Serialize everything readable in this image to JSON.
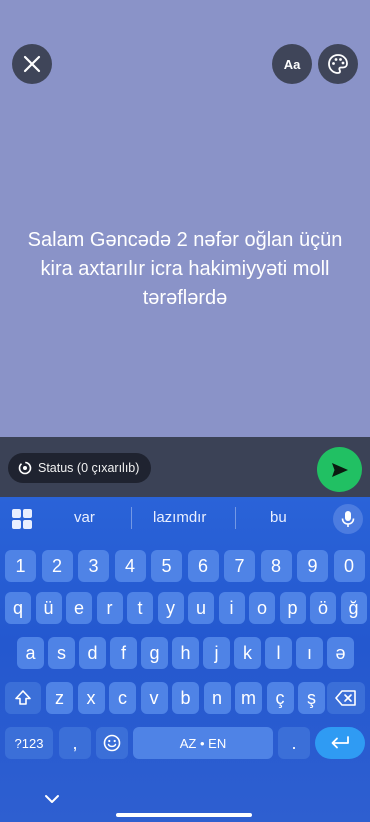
{
  "composer": {
    "background_color": "#8a93c8",
    "status_text": "Salam Gəncədə 2 nəfər oğlan üçün kira axtarılır icra hakimiyyəti moll tərəflərdə",
    "font_button_label": "Aa",
    "close_icon": "close-icon",
    "palette_icon": "palette-icon"
  },
  "bottom_bar": {
    "privacy_label": "Status (0 çıxarılıb)",
    "send_icon": "send-icon",
    "send_color": "#21c063"
  },
  "keyboard": {
    "suggestions": [
      "var",
      "lazımdır",
      "bu"
    ],
    "row_numbers": [
      "1",
      "2",
      "3",
      "4",
      "5",
      "6",
      "7",
      "8",
      "9",
      "0"
    ],
    "row1": [
      "q",
      "ü",
      "e",
      "r",
      "t",
      "y",
      "u",
      "i",
      "o",
      "p",
      "ö",
      "ğ"
    ],
    "row2": [
      "a",
      "s",
      "d",
      "f",
      "g",
      "h",
      "j",
      "k",
      "l",
      "ı",
      "ə"
    ],
    "row3": [
      "z",
      "x",
      "c",
      "v",
      "b",
      "n",
      "m",
      "ç",
      "ş"
    ],
    "symbols_label": "?123",
    "comma_label": ",",
    "space_label": "AZ • EN",
    "period_label": "."
  }
}
